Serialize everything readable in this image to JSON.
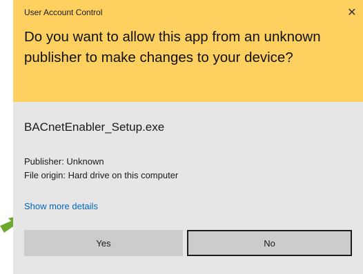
{
  "window": {
    "title": "User Account Control",
    "close_glyph": "✕"
  },
  "header": {
    "question": "Do you want to allow this app from an unknown publisher to make changes to your device?"
  },
  "app": {
    "name": "BACnetEnabler_Setup.exe",
    "publisher": "Publisher: Unknown",
    "origin": "File origin: Hard drive on this computer"
  },
  "details_link": "Show more details",
  "buttons": {
    "yes": "Yes",
    "no": "No"
  },
  "colors": {
    "header_bg": "#fdd060",
    "body_bg": "#e6e6e6",
    "link": "#0067c0",
    "button_bg": "#cccccc",
    "pointer_arrow": "#6ea82f"
  },
  "icons": [
    "close-icon",
    "pointer-arrow-icon"
  ]
}
